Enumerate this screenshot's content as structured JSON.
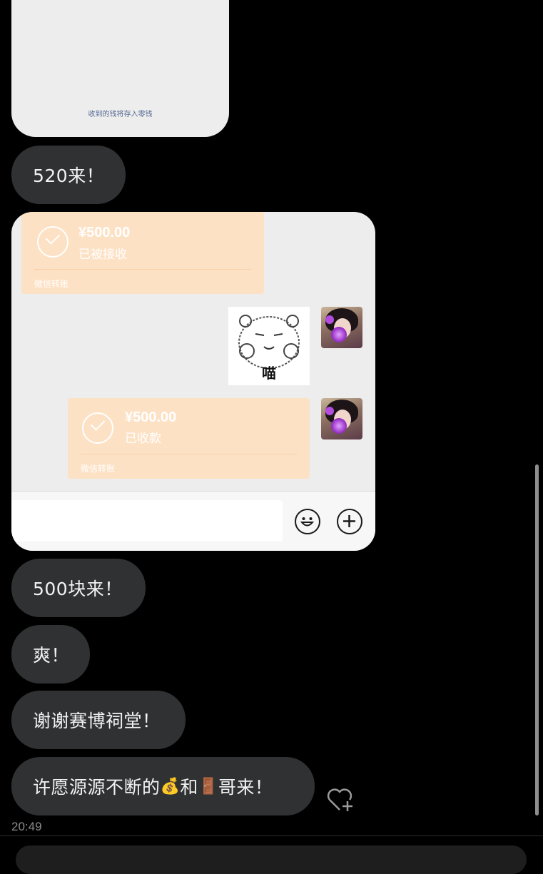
{
  "top_card": {
    "note": "收到的钱将存入零钱"
  },
  "messages": [
    "520来！",
    "500块来！",
    "爽！",
    "谢谢赛博祠堂！"
  ],
  "last_message": {
    "before": "许愿源源不断的",
    "money_emoji": "💰",
    "middle": "和",
    "door_emoji": "🚪",
    "after": "哥来！"
  },
  "transfer_received": {
    "amount": "¥500.00",
    "status": "已被接收",
    "label": "微信转账"
  },
  "transfer_collected": {
    "amount": "¥500.00",
    "status": "已收款",
    "label": "微信转账"
  },
  "sticker": {
    "caption": "喵"
  },
  "timestamp": "20:49",
  "colors": {
    "bubble": "#2f3133",
    "transfer": "#fde1c4",
    "background": "#000000"
  },
  "icons": {
    "emoji_button": "smile-icon",
    "plus_button": "plus-circle-icon",
    "like_add": "heart-plus-icon"
  }
}
